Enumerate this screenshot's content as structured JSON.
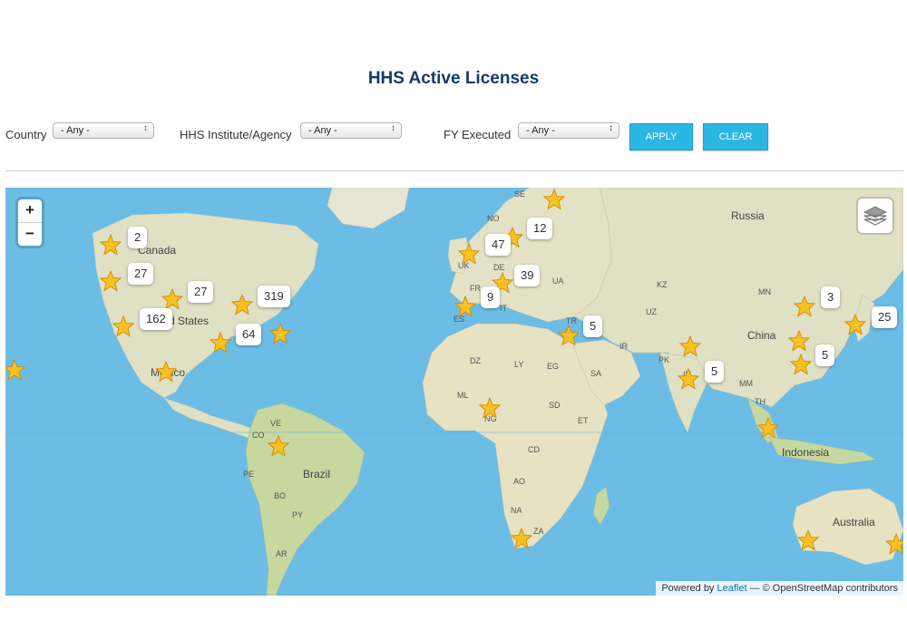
{
  "page": {
    "title": "HHS Active Licenses"
  },
  "filters": {
    "country": {
      "label": "Country",
      "value": "- Any -"
    },
    "agency": {
      "label": "HHS Institute/Agency",
      "value": "- Any -"
    },
    "fy": {
      "label": "FY Executed",
      "value": "- Any -"
    },
    "apply_label": "APPLY",
    "clear_label": "CLEAR"
  },
  "map": {
    "zoom_in": "+",
    "zoom_out": "−",
    "attribution": {
      "prefix": "Powered by ",
      "link": "Leaflet",
      "suffix": " — © OpenStreetMap contributors"
    },
    "place_labels": [
      "Canada",
      "d States",
      "Mexico",
      "Brazil",
      "Russia",
      "China",
      "Indonesia",
      "Australia"
    ],
    "country_codes": [
      "SE",
      "NO",
      "UK",
      "DE",
      "FR",
      "ES",
      "IT",
      "UA",
      "TR",
      "KZ",
      "MN",
      "UZ",
      "IR",
      "PK",
      "IN",
      "MM",
      "TH",
      "DZ",
      "LY",
      "EG",
      "SA",
      "ML",
      "NG",
      "SD",
      "ET",
      "CD",
      "AO",
      "NA",
      "ZA",
      "VE",
      "CO",
      "PE",
      "BO",
      "PY",
      "AR"
    ],
    "cluster_counts": [
      "2",
      "27",
      "27",
      "162",
      "319",
      "64",
      "47",
      "12",
      "39",
      "9",
      "5",
      "5",
      "3",
      "25",
      "5"
    ],
    "colors": {
      "water": "#6bbde6",
      "land": "#e8e3cc",
      "green": "#c9d9a4",
      "marker": "#f8c120",
      "button": "#2cb6e4"
    }
  }
}
